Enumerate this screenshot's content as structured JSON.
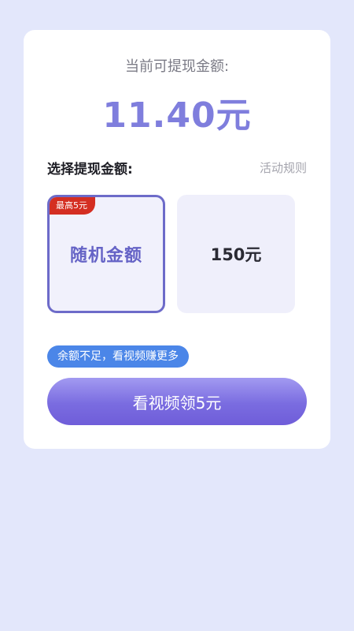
{
  "balance": {
    "label": "当前可提现金额:",
    "amount": "11.40元"
  },
  "withdraw": {
    "title": "选择提现金额:",
    "rules_link": "活动规则",
    "options": [
      {
        "label": "随机金额",
        "badge": "最高5元",
        "selected": true
      },
      {
        "label": "150元",
        "selected": false
      }
    ]
  },
  "tip": "余额不足，看视频赚更多",
  "cta_label": "看视频领5元",
  "colors": {
    "page_bg": "#e3e7fb",
    "accent": "#7f7edd",
    "selected_border": "#6d6bc9",
    "badge": "#d42e22",
    "tip_pill": "#4b86e8"
  }
}
